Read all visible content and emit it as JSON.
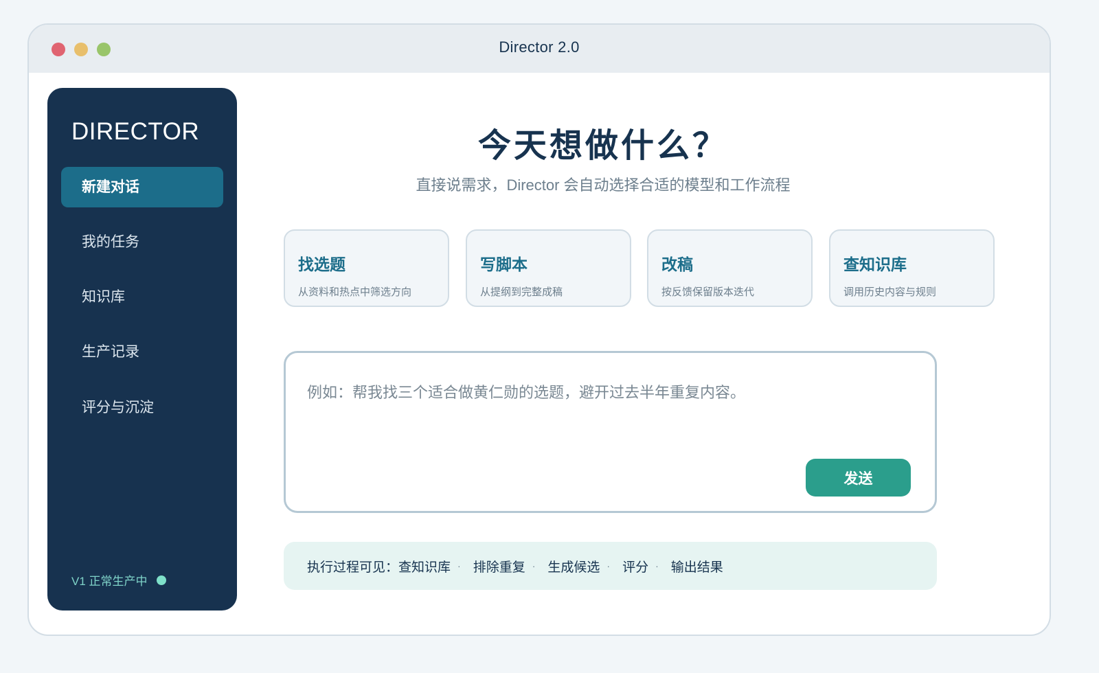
{
  "window": {
    "title": "Director 2.0"
  },
  "sidebar": {
    "brand": "DIRECTOR",
    "items": [
      {
        "label": "新建对话",
        "active": true
      },
      {
        "label": "我的任务",
        "active": false
      },
      {
        "label": "知识库",
        "active": false
      },
      {
        "label": "生产记录",
        "active": false
      },
      {
        "label": "评分与沉淀",
        "active": false
      }
    ],
    "status": "V1 正常生产中"
  },
  "main": {
    "headline": "今天想做什么？",
    "subhead": "直接说需求，Director 会自动选择合适的模型和工作流程",
    "cards": [
      {
        "title": "找选题",
        "desc": "从资料和热点中筛选方向"
      },
      {
        "title": "写脚本",
        "desc": "从提纲到完整成稿"
      },
      {
        "title": "改稿",
        "desc": "按反馈保留版本迭代"
      },
      {
        "title": "查知识库",
        "desc": "调用历史内容与规则"
      }
    ],
    "composer": {
      "value": "",
      "placeholder": "例如：帮我找三个适合做黄仁勋的选题，避开过去半年重复内容。",
      "send_label": "发送"
    },
    "process": {
      "prefix": "执行过程可见：",
      "steps": [
        "查知识库",
        "排除重复",
        "生成候选",
        "评分",
        "输出结果"
      ],
      "separator": "·"
    }
  },
  "colors": {
    "accent": "#1c6d8a",
    "sidebar_bg": "#17324f",
    "send_button": "#2b9e8c",
    "status_dot": "#7ee0c9",
    "window_close": "#e06471",
    "window_minimize": "#e8bf6c",
    "window_zoom": "#99c56a"
  }
}
